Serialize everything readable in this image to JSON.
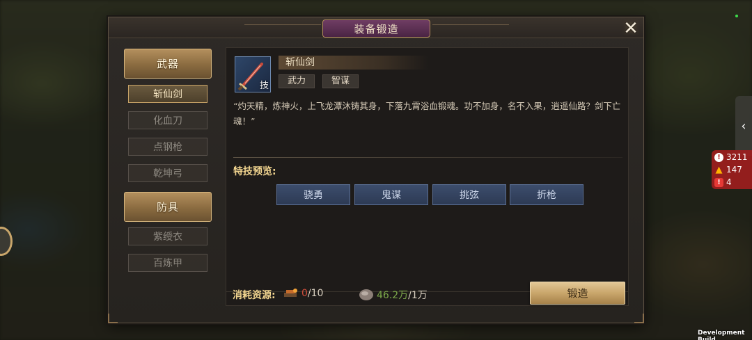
{
  "window": {
    "title": "装备锻造",
    "close_icon": "close-x-icon"
  },
  "categories": [
    {
      "label": "武器",
      "items": [
        {
          "label": "斩仙剑",
          "active": true
        },
        {
          "label": "化血刀",
          "active": false
        },
        {
          "label": "点钢枪",
          "active": false
        },
        {
          "label": "乾坤弓",
          "active": false
        }
      ]
    },
    {
      "label": "防具",
      "items": [
        {
          "label": "紫绶衣",
          "active": false
        },
        {
          "label": "百炼甲",
          "active": false
        }
      ]
    }
  ],
  "item": {
    "name": "斩仙剑",
    "icon": "sword-icon",
    "icon_tag": "技",
    "tags": [
      "武力",
      "智谋"
    ],
    "description": "“灼天精，炼神火，上飞龙潭沐铸其身，下落九霄浴血锻魂。功不加身，名不入果，逍遥仙路？剑下亡魂！”"
  },
  "skills": {
    "label": "特技预览:",
    "items": [
      "骁勇",
      "鬼谋",
      "挑弦",
      "折枪"
    ]
  },
  "resources": {
    "label": "消耗资源:",
    "items": [
      {
        "icon": "forge-material-icon",
        "have": "0",
        "need": "/10"
      },
      {
        "icon": "ore-stone-icon",
        "have": "46.2万",
        "need": "/1万"
      }
    ]
  },
  "forge_button": "锻造",
  "hud": {
    "side_tab_icon": "chevron-left-icon",
    "alerts": [
      {
        "icon": "info-icon",
        "value": "3211"
      },
      {
        "icon": "warning-icon",
        "value": "147"
      },
      {
        "icon": "error-icon",
        "value": "4"
      }
    ],
    "dev_build": "Development Build"
  },
  "colors": {
    "accent_gold": "#c9a66b",
    "title_purple": "#5a2d52",
    "skill_blue": "#34445f",
    "resource_red": "#d24e3b",
    "resource_green": "#7ca94a",
    "alert_red": "#a01e1e"
  }
}
